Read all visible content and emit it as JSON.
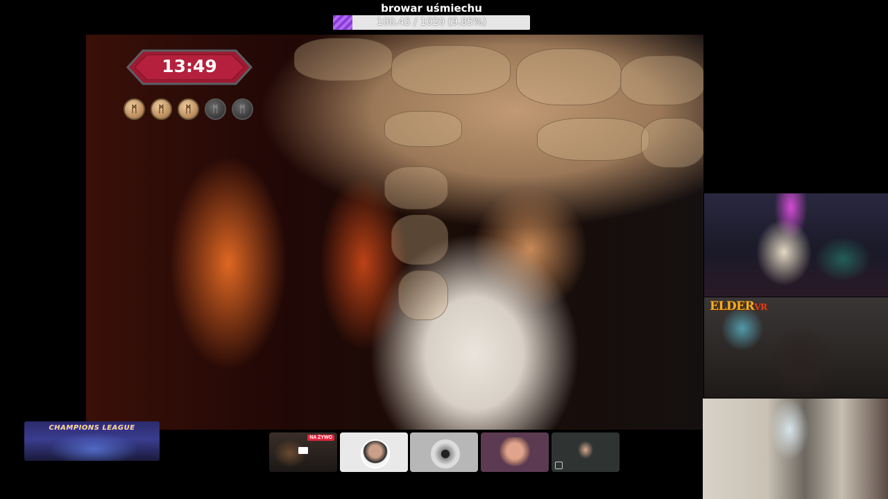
{
  "goal": {
    "title": "browar uśmiechu",
    "progress_text": "100.45 / 1020 (9.85%)",
    "current": 100.45,
    "target": 1020,
    "percent": 9.85
  },
  "stream_overlay": {
    "timer": "13:49",
    "coins": {
      "total": 5,
      "active": 3,
      "symbol": "ᛗ"
    }
  },
  "cams": {
    "cam2_logo_main": "ELDER",
    "cam2_logo_suffix": "VR"
  },
  "banner": {
    "label": "CHAMPIONS LEAGUE"
  },
  "thumbnails": {
    "live_badge": "NA ŻYWO",
    "items": [
      "screen-share",
      "participant-avatar",
      "car-avatar",
      "face-avatar",
      "participant-camera"
    ]
  },
  "colors": {
    "progress_fill": "#8b3bd9",
    "live_badge": "#e2253c",
    "timer_plate": "#9e1b32"
  }
}
